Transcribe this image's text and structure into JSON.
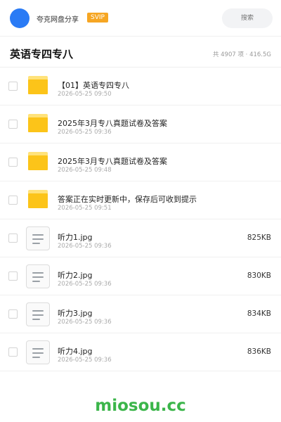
{
  "header": {
    "app_name": "夸克网盘分享",
    "badge": "SVIP",
    "search_placeholder": "搜索"
  },
  "folder": {
    "title": "英语专四专八",
    "summary": "共 4907 项 · 416.5G"
  },
  "items": [
    {
      "type": "folder",
      "name": "【01】英语专四专八",
      "date": "2026-05-25 09:50",
      "size": ""
    },
    {
      "type": "folder",
      "name": "2025年3月专八真题试卷及答案",
      "date": "2026-05-25 09:36",
      "size": ""
    },
    {
      "type": "folder",
      "name": "2025年3月专八真题试卷及答案",
      "date": "2026-05-25 09:48",
      "size": ""
    },
    {
      "type": "folder",
      "name": "答案正在实时更新中，保存后可收到提示",
      "date": "2026-05-25 09:51",
      "size": ""
    },
    {
      "type": "file",
      "name": "听力1.jpg",
      "date": "2026-05-25 09:36",
      "size": "825KB"
    },
    {
      "type": "file",
      "name": "听力2.jpg",
      "date": "2026-05-25 09:36",
      "size": "830KB"
    },
    {
      "type": "file",
      "name": "听力3.jpg",
      "date": "2026-05-25 09:36",
      "size": "834KB"
    },
    {
      "type": "file",
      "name": "听力4.jpg",
      "date": "2026-05-25 09:36",
      "size": "836KB"
    }
  ],
  "watermark": "miosou.cc",
  "colors": {
    "accent": "#2a7bf5",
    "badge": "#f6a623",
    "folder": "#fcc419",
    "watermark": "#3bb54a"
  },
  "icons": {
    "folder": "folder-icon",
    "file": "document-icon"
  }
}
